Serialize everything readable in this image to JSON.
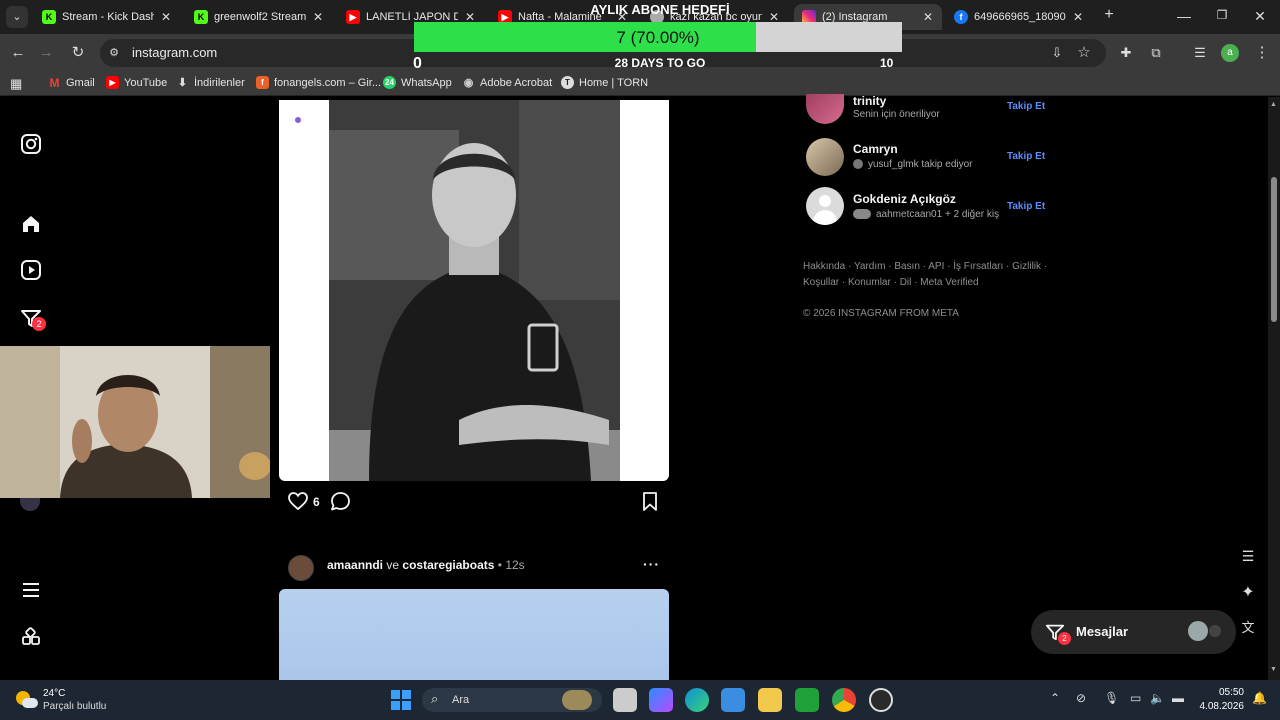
{
  "browser": {
    "tabs": [
      {
        "title": "Stream - Kick Dashbo",
        "icon": "kick-icon",
        "color": "#53fc18"
      },
      {
        "title": "greenwolf2 Stream -",
        "icon": "kick-icon",
        "color": "#53fc18"
      },
      {
        "title": "LANETLİ JAPON DEN",
        "icon": "youtube-icon",
        "color": "#ff0000"
      },
      {
        "title": "Nafta - Malamine",
        "icon": "youtube-icon",
        "color": "#ff0000"
      },
      {
        "title": "kazı kazan bc oyunu",
        "icon": "chrome-icon",
        "color": "#aaaaaa"
      },
      {
        "title": "(2) Instagram",
        "icon": "instagram-icon",
        "color": "#e1306c",
        "active": true
      },
      {
        "title": "649666965_1809062",
        "icon": "facebook-icon",
        "color": "#1877f2"
      }
    ],
    "url": "instagram.com",
    "bookmarks": [
      {
        "label": "Gmail",
        "icon": "gmail-icon",
        "color": "#ea4335"
      },
      {
        "label": "YouTube",
        "icon": "youtube-icon",
        "color": "#ff0000"
      },
      {
        "label": "İndirilenler",
        "icon": "download-icon",
        "color": "#cccccc"
      },
      {
        "label": "fonangels.com – Gir...",
        "icon": "fonangels-icon",
        "color": "#e8622a"
      },
      {
        "label": "WhatsApp",
        "icon": "whatsapp-icon",
        "color": "#25d366",
        "badge": "24"
      },
      {
        "label": "Adobe Acrobat",
        "icon": "acrobat-icon",
        "color": "#cccccc"
      },
      {
        "label": "Home | TORN",
        "icon": "torn-icon",
        "color": "#dddddd",
        "badge": "T"
      }
    ]
  },
  "overlay": {
    "title": "AYLIK ABONE HEDEFİ",
    "progress_text": "7 (70.00%)",
    "progress_fraction": 0.7,
    "start": "0",
    "end": "10",
    "days_left": "28 DAYS TO GO",
    "fill_color": "#2de04a"
  },
  "sidebar": {
    "notification_count": "2"
  },
  "post": {
    "likes": "6"
  },
  "next_post": {
    "user1": "amaanndi",
    "joiner": "ve",
    "user2": "costaregiaboats",
    "time": "12s"
  },
  "suggestions": [
    {
      "name": "trinity",
      "subtitle": "Senin için öneriliyor",
      "action": "Takip Et"
    },
    {
      "name": "Camryn",
      "subtitle": "yusuf_glmk takip ediyor",
      "action": "Takip Et"
    },
    {
      "name": "Gokdeniz Açıkgöz",
      "subtitle": "aahmetcaan01 + 2 diğer kiş",
      "action": "Takip Et"
    }
  ],
  "footer": {
    "line1": "Hakkında · Yardım · Basın · API · İş Fırsatları · Gizlilik ·",
    "line2": "Koşullar · Konumlar · Dil · Meta Verified",
    "copyright": "© 2026 INSTAGRAM FROM META"
  },
  "messages": {
    "label": "Mesajlar",
    "badge": "2"
  },
  "taskbar": {
    "temperature": "24°C",
    "weather": "Parçalı bulutlu",
    "search": "Ara",
    "time": "05:50",
    "date": "4.08.2026"
  }
}
